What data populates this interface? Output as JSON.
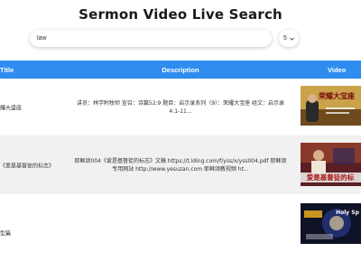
{
  "page": {
    "title": "Sermon Video Live Search"
  },
  "search": {
    "value": "law"
  },
  "count_select": {
    "value": "5"
  },
  "table": {
    "headers": {
      "title": "Title",
      "description": "Description",
      "video": "Video"
    },
    "rows": [
      {
        "title": "耀大盛座",
        "description": "讲员：林学附牧师 宣召：诗篇52:9 题目：启示录系列（9）：荣耀大宝座 经文：启示录4:1-11...",
        "thumb_text": "荣耀大宝座"
      },
      {
        "title": "《爱是基督徒的标志》",
        "description": "耶稣颂004《爱是基督徒的标志》文稿 https://t.lding.com/f/yss/x/yss004.pdf 耶稣颂专用网站 http://www.yesuzan.com 耶稣颂教视频 ht...",
        "thumb_text": "爱是基督徒的标"
      },
      {
        "title": "型篇",
        "description": "",
        "thumb_text": "Holy Sp"
      }
    ]
  },
  "colors": {
    "accent": "#2e8def",
    "row_alt": "#f1f1f1"
  }
}
